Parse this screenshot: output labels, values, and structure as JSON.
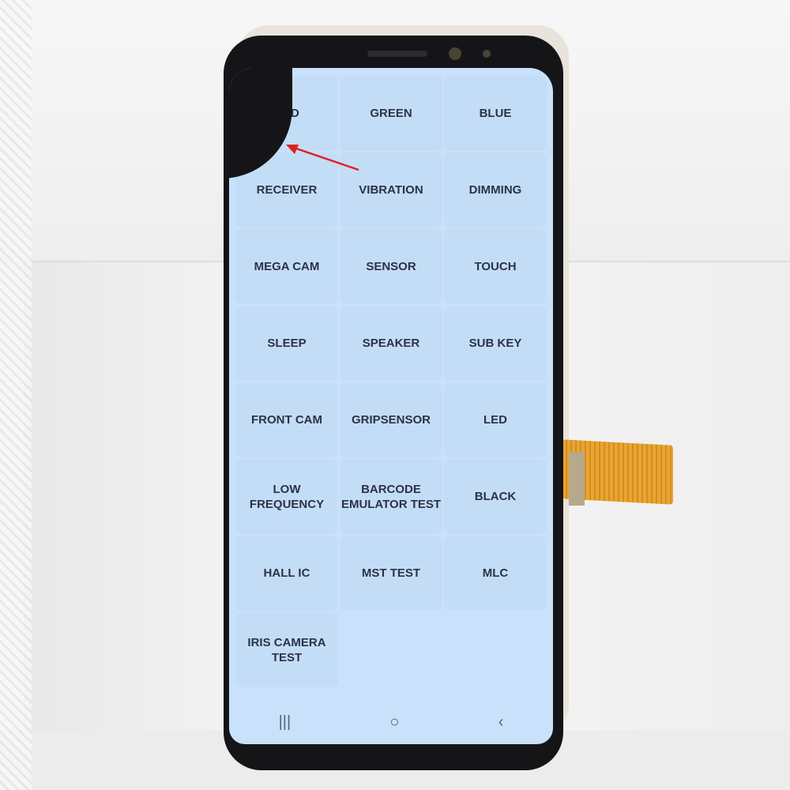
{
  "test_menu": {
    "items": [
      "RED",
      "GREEN",
      "BLUE",
      "RECEIVER",
      "VIBRATION",
      "DIMMING",
      "MEGA CAM",
      "SENSOR",
      "TOUCH",
      "SLEEP",
      "SPEAKER",
      "SUB KEY",
      "FRONT CAM",
      "GRIPSENSOR",
      "LED",
      "LOW FREQUENCY",
      "BARCODE EMULATOR TEST",
      "BLACK",
      "HALL IC",
      "MST TEST",
      "MLC",
      "IRIS CAMERA TEST"
    ]
  },
  "nav_bar": {
    "recents_icon": "|||",
    "home_icon": "○",
    "back_icon": "‹"
  },
  "colors": {
    "screen": "#c9e1fa",
    "text": "#2a3346",
    "annotation_arrow": "#e02020"
  }
}
